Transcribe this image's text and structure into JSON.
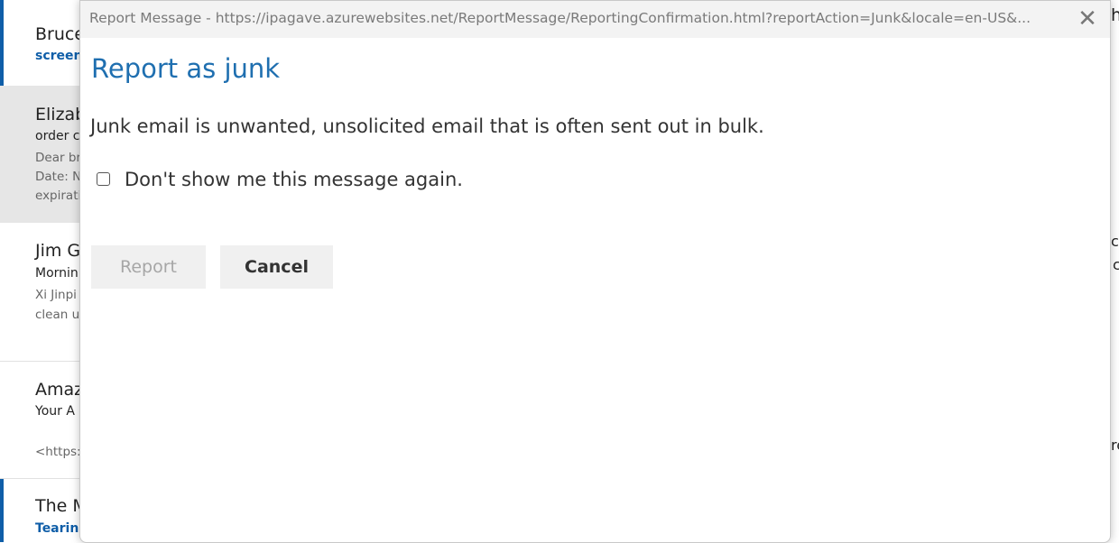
{
  "background_list": [
    {
      "sender": "Bruce",
      "subject": "screen",
      "preview": []
    },
    {
      "sender": "Elizab",
      "subject": "order c",
      "preview": [
        "Dear br",
        "Date: N",
        "expirati"
      ]
    },
    {
      "sender": "Jim G",
      "subject": "Mornin",
      "preview": [
        "Xi Jinpi",
        "clean u"
      ]
    },
    {
      "sender": "Amaz",
      "subject": "Your A",
      "preview": [
        "<https:"
      ]
    },
    {
      "sender": "The M",
      "subject": "Tearin",
      "preview": []
    }
  ],
  "right_fragments": [
    "h",
    "cr",
    "c",
    "re"
  ],
  "dialog": {
    "title": "Report Message - https://ipagave.azurewebsites.net/ReportMessage/ReportingConfirmation.html?reportAction=Junk&locale=en-US&...",
    "close_icon": "close-icon",
    "heading": "Report as junk",
    "description": "Junk email is unwanted, unsolicited email that is often sent out in bulk.",
    "checkbox_label": "Don't show me this message again.",
    "checkbox_checked": false,
    "report_label": "Report",
    "cancel_label": "Cancel"
  },
  "colors": {
    "accent": "#1f6fb0",
    "unread_bar": "#0f5ea8",
    "selected_row": "#e6e6e6"
  }
}
